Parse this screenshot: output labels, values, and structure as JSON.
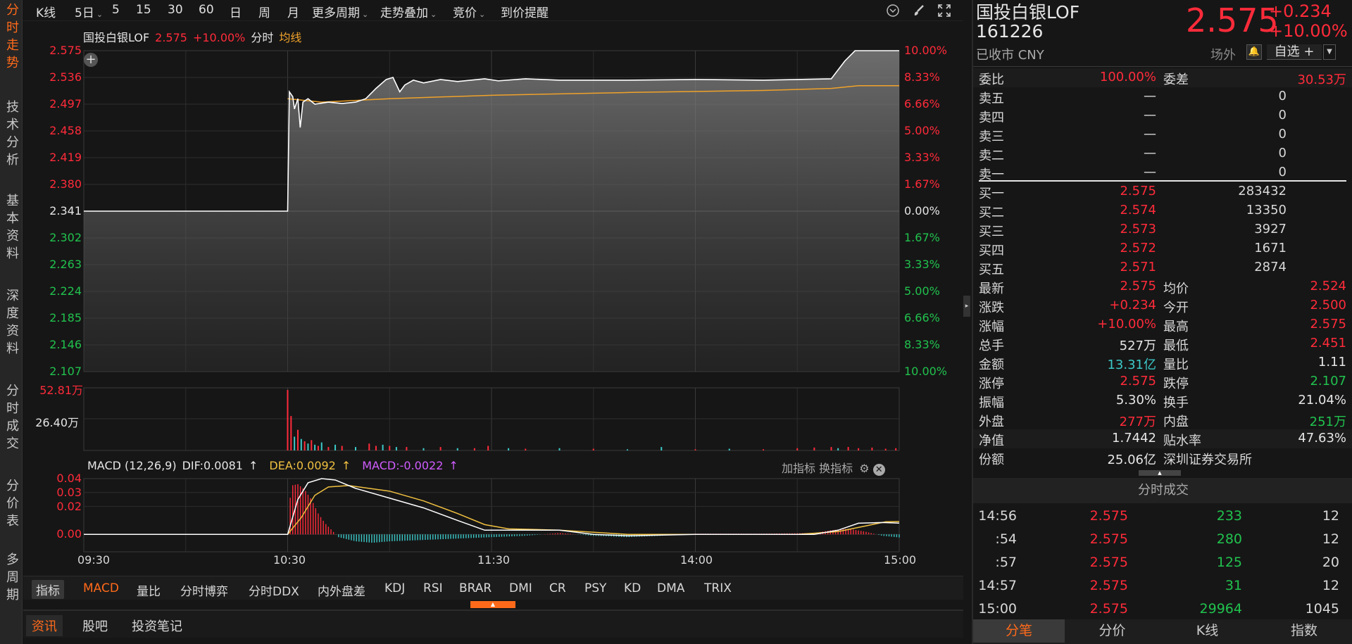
{
  "sidebar": {
    "tabs": [
      "分时走势",
      "技术分析",
      "基本资料",
      "深度资料",
      "分时成交",
      "分价表",
      "多周期"
    ]
  },
  "toolbar": {
    "items": [
      "K线",
      "5日",
      "5",
      "15",
      "30",
      "60",
      "日",
      "周",
      "月",
      "更多周期",
      "走势叠加",
      "竞价",
      "到价提醒"
    ],
    "dropdowns": [
      false,
      true,
      false,
      false,
      false,
      false,
      false,
      false,
      false,
      true,
      true,
      true,
      false
    ]
  },
  "chart_header": {
    "name": "国投白银LOF",
    "price": "2.575",
    "change_pct": "+10.00%",
    "mode": "分时",
    "avg_label": "均线"
  },
  "price_axis": {
    "left": [
      "2.575",
      "2.536",
      "2.497",
      "2.458",
      "2.419",
      "2.380",
      "2.341",
      "2.302",
      "2.263",
      "2.224",
      "2.185",
      "2.146",
      "2.107"
    ],
    "right": [
      "10.00%",
      "8.33%",
      "6.66%",
      "5.00%",
      "3.33%",
      "1.67%",
      "0.00%",
      "1.67%",
      "3.33%",
      "5.00%",
      "6.66%",
      "8.33%",
      "10.00%"
    ]
  },
  "volume_axis": [
    "52.81万",
    "26.40万"
  ],
  "macd": {
    "title": "MACD (12,26,9)",
    "dif": "DIF:0.0081",
    "dea": "DEA:0.0092",
    "macd": "MACD:-0.0022",
    "arrow": "↑",
    "add_indicator": "加指标",
    "switch_indicator": "换指标",
    "axis": [
      "0.04",
      "0.03",
      "0.02",
      "0.00"
    ]
  },
  "time_axis": [
    "09:30",
    "10:30",
    "11:30",
    "14:00",
    "15:00"
  ],
  "indicator_bar": {
    "label": "指标",
    "items": [
      "MACD",
      "量比",
      "分时博弈",
      "分时DDX",
      "内外盘差",
      "KDJ",
      "RSI",
      "BRAR",
      "DMI",
      "CR",
      "PSY",
      "KD",
      "DMA",
      "TRIX"
    ]
  },
  "bottom_tabs": [
    "资讯",
    "股吧",
    "投资笔记"
  ],
  "quote": {
    "name": "国投白银LOF",
    "code": "161226",
    "status": "已收市 CNY",
    "price": "2.575",
    "change": "+0.234",
    "change_pct": "+10.00%",
    "market": "场外",
    "watchlist": "自选 +"
  },
  "order_book": {
    "ratio_label": "委比",
    "ratio": "100.00%",
    "diff_label": "委差",
    "diff": "30.53万",
    "asks": [
      {
        "label": "卖五",
        "price": "—",
        "vol": "0"
      },
      {
        "label": "卖四",
        "price": "—",
        "vol": "0"
      },
      {
        "label": "卖三",
        "price": "—",
        "vol": "0"
      },
      {
        "label": "卖二",
        "price": "—",
        "vol": "0"
      },
      {
        "label": "卖一",
        "price": "—",
        "vol": "0"
      }
    ],
    "bids": [
      {
        "label": "买一",
        "price": "2.575",
        "vol": "283432"
      },
      {
        "label": "买二",
        "price": "2.574",
        "vol": "13350"
      },
      {
        "label": "买三",
        "price": "2.573",
        "vol": "3927"
      },
      {
        "label": "买四",
        "price": "2.572",
        "vol": "1671"
      },
      {
        "label": "买五",
        "price": "2.571",
        "vol": "2874"
      }
    ]
  },
  "stats": [
    {
      "l1": "最新",
      "v1": "2.575",
      "c1": "red",
      "l2": "均价",
      "v2": "2.524",
      "c2": "red"
    },
    {
      "l1": "涨跌",
      "v1": "+0.234",
      "c1": "red",
      "l2": "今开",
      "v2": "2.500",
      "c2": "red"
    },
    {
      "l1": "涨幅",
      "v1": "+10.00%",
      "c1": "red",
      "l2": "最高",
      "v2": "2.575",
      "c2": "red"
    },
    {
      "l1": "总手",
      "v1": "527万",
      "c1": "white",
      "l2": "最低",
      "v2": "2.451",
      "c2": "red"
    },
    {
      "l1": "金额",
      "v1": "13.31亿",
      "c1": "cyan",
      "l2": "量比",
      "v2": "1.11",
      "c2": "white"
    },
    {
      "l1": "涨停",
      "v1": "2.575",
      "c1": "red",
      "l2": "跌停",
      "v2": "2.107",
      "c2": "green"
    },
    {
      "l1": "振幅",
      "v1": "5.30%",
      "c1": "white",
      "l2": "换手",
      "v2": "21.04%",
      "c2": "white"
    },
    {
      "l1": "外盘",
      "v1": "277万",
      "c1": "red",
      "l2": "内盘",
      "v2": "251万",
      "c2": "green"
    },
    {
      "l1": "净值",
      "v1": "1.7442",
      "c1": "white",
      "l2": "贴水率",
      "v2": "47.63%",
      "c2": "white"
    },
    {
      "l1": "份额",
      "v1": "25.06亿",
      "c1": "white",
      "l2": "深圳证券交易所",
      "v2": "",
      "c2": "white"
    }
  ],
  "ticks": {
    "title": "分时成交",
    "rows": [
      {
        "time": "14:56",
        "price": "2.575",
        "vol": "233",
        "count": "12"
      },
      {
        "time": ":54",
        "price": "2.575",
        "vol": "280",
        "count": "12"
      },
      {
        "time": ":57",
        "price": "2.575",
        "vol": "125",
        "count": "20"
      },
      {
        "time": "14:57",
        "price": "2.575",
        "vol": "31",
        "count": "12"
      },
      {
        "time": "15:00",
        "price": "2.575",
        "vol": "29964",
        "count": "1045"
      }
    ]
  },
  "right_tabs": [
    "分笔",
    "分价",
    "K线",
    "指数"
  ],
  "colors": {
    "up": "#ff2b3a",
    "down": "#21c24e",
    "avg": "#f0a22a",
    "price_line": "#ffffff",
    "accent": "#ff6a1a",
    "cyan": "#3cc8c8",
    "macd_purple": "#d05cff"
  },
  "chart_data": [
    {
      "type": "line",
      "title": "分时",
      "x_unit": "minutes since 09:30 (trading)",
      "xlim": [
        0,
        240
      ],
      "ylim": [
        2.107,
        2.575
      ],
      "prev_close": 2.341,
      "series": [
        {
          "name": "price",
          "points": [
            [
              0,
              2.341
            ],
            [
              60,
              2.341
            ],
            [
              60.5,
              2.515
            ],
            [
              61.5,
              2.508
            ],
            [
              62,
              2.49
            ],
            [
              63,
              2.505
            ],
            [
              63.7,
              2.463
            ],
            [
              64.5,
              2.5
            ],
            [
              66,
              2.505
            ],
            [
              68,
              2.497
            ],
            [
              72,
              2.5
            ],
            [
              76,
              2.498
            ],
            [
              80,
              2.5
            ],
            [
              83,
              2.505
            ],
            [
              86,
              2.52
            ],
            [
              89,
              2.533
            ],
            [
              91,
              2.536
            ],
            [
              93,
              2.515
            ],
            [
              94.5,
              2.525
            ],
            [
              97,
              2.532
            ],
            [
              100,
              2.528
            ],
            [
              105,
              2.533
            ],
            [
              110,
              2.53
            ],
            [
              118,
              2.534
            ],
            [
              122,
              2.531
            ],
            [
              130,
              2.534
            ],
            [
              140,
              2.532
            ],
            [
              160,
              2.532
            ],
            [
              180,
              2.533
            ],
            [
              200,
              2.532
            ],
            [
              220,
              2.534
            ],
            [
              224,
              2.56
            ],
            [
              227,
              2.575
            ],
            [
              240,
              2.575
            ]
          ]
        },
        {
          "name": "均线",
          "points": [
            [
              60,
              2.505
            ],
            [
              70,
              2.5
            ],
            [
              90,
              2.505
            ],
            [
              120,
              2.51
            ],
            [
              160,
              2.514
            ],
            [
              200,
              2.517
            ],
            [
              220,
              2.52
            ],
            [
              228,
              2.524
            ],
            [
              240,
              2.524
            ]
          ]
        }
      ]
    },
    {
      "type": "bar",
      "title": "volume",
      "unit": "万",
      "ylim": [
        0,
        52.81
      ],
      "bars": [
        [
          60,
          52.81,
          "u"
        ],
        [
          61,
          30,
          "u"
        ],
        [
          62,
          12,
          "d"
        ],
        [
          63,
          18,
          "u"
        ],
        [
          64,
          10,
          "d"
        ],
        [
          65,
          8,
          "u"
        ],
        [
          66,
          6,
          "d"
        ],
        [
          67,
          9,
          "u"
        ],
        [
          68,
          5,
          "d"
        ],
        [
          69,
          4,
          "u"
        ],
        [
          70,
          7,
          "d"
        ],
        [
          72,
          3,
          "u"
        ],
        [
          74,
          5,
          "d"
        ],
        [
          76,
          4,
          "u"
        ],
        [
          80,
          3,
          "d"
        ],
        [
          84,
          6,
          "u"
        ],
        [
          86,
          4,
          "u"
        ],
        [
          88,
          5,
          "d"
        ],
        [
          90,
          4,
          "u"
        ],
        [
          92,
          3,
          "d"
        ],
        [
          95,
          3,
          "u"
        ],
        [
          100,
          2,
          "d"
        ],
        [
          105,
          3,
          "u"
        ],
        [
          110,
          2,
          "d"
        ],
        [
          115,
          2,
          "u"
        ],
        [
          119,
          4,
          "u"
        ],
        [
          125,
          2,
          "d"
        ],
        [
          130,
          1.5,
          "u"
        ],
        [
          140,
          2,
          "d"
        ],
        [
          150,
          1.5,
          "u"
        ],
        [
          160,
          1,
          "d"
        ],
        [
          170,
          3,
          "d"
        ],
        [
          180,
          1,
          "u"
        ],
        [
          190,
          1.5,
          "d"
        ],
        [
          200,
          1,
          "u"
        ],
        [
          210,
          2,
          "u"
        ],
        [
          215,
          2.5,
          "u"
        ],
        [
          220,
          3,
          "u"
        ],
        [
          222,
          2,
          "d"
        ],
        [
          225,
          3,
          "u"
        ],
        [
          228,
          2,
          "u"
        ],
        [
          232,
          2.5,
          "u"
        ],
        [
          236,
          1.5,
          "u"
        ],
        [
          239,
          2,
          "u"
        ]
      ]
    },
    {
      "type": "line",
      "title": "MACD (12,26,9)",
      "ylim": [
        -0.0125,
        0.04
      ],
      "dif": [
        [
          0,
          0
        ],
        [
          60,
          0
        ],
        [
          63,
          0.025
        ],
        [
          66,
          0.037
        ],
        [
          70,
          0.04
        ],
        [
          74,
          0.039
        ],
        [
          80,
          0.033
        ],
        [
          90,
          0.026
        ],
        [
          100,
          0.019
        ],
        [
          110,
          0.01
        ],
        [
          118,
          0.003
        ],
        [
          130,
          0.003
        ],
        [
          140,
          0.003
        ],
        [
          150,
          0
        ],
        [
          160,
          -0.001
        ],
        [
          180,
          0
        ],
        [
          215,
          0
        ],
        [
          222,
          0.003
        ],
        [
          228,
          0.008
        ],
        [
          235,
          0.0085
        ],
        [
          240,
          0.0081
        ]
      ],
      "dea": [
        [
          0,
          0
        ],
        [
          60,
          0
        ],
        [
          64,
          0.012
        ],
        [
          68,
          0.028
        ],
        [
          72,
          0.034
        ],
        [
          78,
          0.035
        ],
        [
          90,
          0.031
        ],
        [
          100,
          0.024
        ],
        [
          110,
          0.015
        ],
        [
          118,
          0.007
        ],
        [
          125,
          0.004
        ],
        [
          140,
          0.003
        ],
        [
          160,
          0
        ],
        [
          210,
          0
        ],
        [
          222,
          0.002
        ],
        [
          230,
          0.006
        ],
        [
          236,
          0.009
        ],
        [
          240,
          0.0092
        ]
      ],
      "hist": [
        [
          60,
          0
        ],
        [
          61,
          0.035
        ],
        [
          63,
          0.036
        ],
        [
          65,
          0.032
        ],
        [
          67,
          0.025
        ],
        [
          69,
          0.015
        ],
        [
          71,
          0.008
        ],
        [
          73,
          0.003
        ],
        [
          75,
          -0.002
        ],
        [
          80,
          -0.005
        ],
        [
          85,
          -0.006
        ],
        [
          90,
          -0.005
        ],
        [
          100,
          -0.004
        ],
        [
          110,
          -0.003
        ],
        [
          120,
          -0.002
        ],
        [
          130,
          -0.001
        ],
        [
          140,
          0.001
        ],
        [
          150,
          -0.001
        ],
        [
          160,
          -0.002
        ],
        [
          170,
          -0.001
        ],
        [
          180,
          0.0005
        ],
        [
          200,
          0.0005
        ],
        [
          215,
          0.001
        ],
        [
          220,
          0.003
        ],
        [
          225,
          0.004
        ],
        [
          230,
          0.002
        ],
        [
          235,
          -0.001
        ],
        [
          240,
          -0.0022
        ]
      ]
    }
  ]
}
